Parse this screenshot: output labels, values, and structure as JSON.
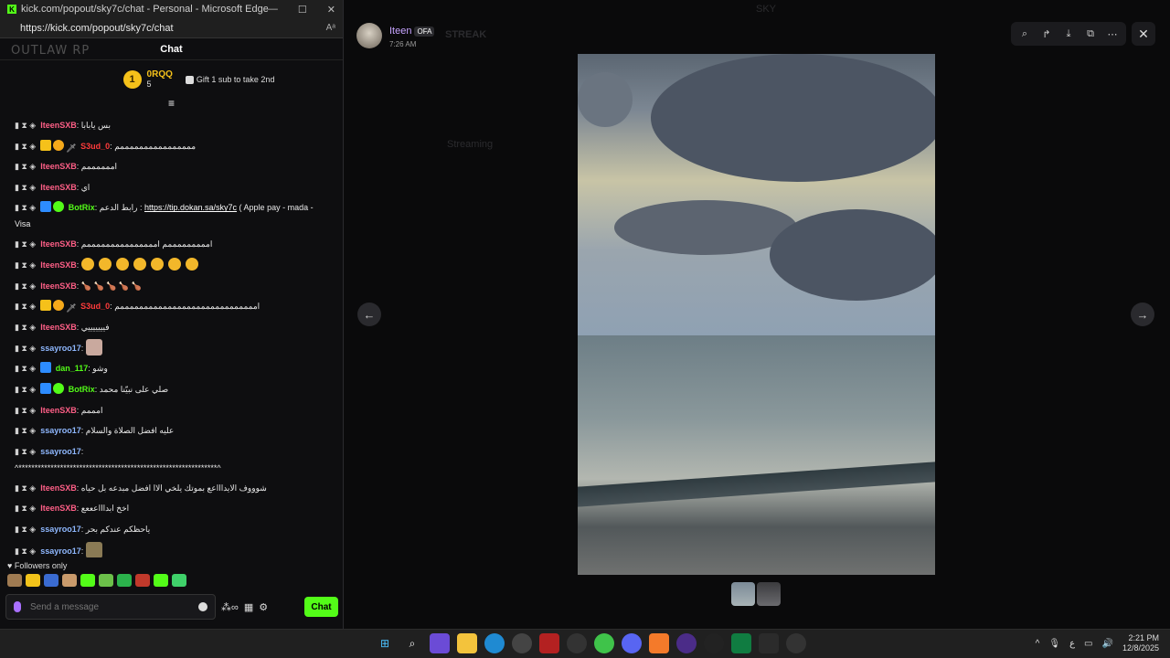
{
  "edge": {
    "title": "kick.com/popout/sky7c/chat - Personal - Microsoft Edge",
    "url": "https://kick.com/popout/sky7c/chat",
    "minimize": "—",
    "maximize": "☐",
    "close": "✕"
  },
  "chat": {
    "header": "Chat",
    "watermark": "OUTLAW RP",
    "top_gifter": {
      "rank": "1",
      "name": "0RQQ",
      "count": "5"
    },
    "gift_cta": "Gift 1 sub to take 2nd",
    "messages": [
      {
        "user": "IteenSXB",
        "text": "بس يابابا"
      },
      {
        "user": "S3ud_0",
        "text": "ممممممممممممممممم"
      },
      {
        "user": "IteenSXB",
        "text": "اممممممم"
      },
      {
        "user": "IteenSXB",
        "text": "اي"
      },
      {
        "user": "BotRix",
        "text_before": "رابط الدعم : ",
        "link": "https://tip.dokan.sa/sky7c",
        "text_after": " ( Apple pay - mada - Visa"
      },
      {
        "user": "IteenSXB",
        "text": "امممممممممم امممممممممممممممم"
      },
      {
        "user": "IteenSXB",
        "text": ""
      },
      {
        "user": "IteenSXB",
        "text": "🍗 🍗 🍗 🍗 🍗"
      },
      {
        "user": "S3ud_0",
        "text": "امممممممممممممممممممممممممممممم"
      },
      {
        "user": "IteenSXB",
        "text": "فيييييييي"
      },
      {
        "user": "ssayroo17",
        "text": ""
      },
      {
        "user": "dan_117",
        "text": "وشو"
      },
      {
        "user": "BotRix",
        "text": "صلي على نبيّنا محمد"
      },
      {
        "user": "IteenSXB",
        "text": "امممم"
      },
      {
        "user": "ssayroo17",
        "text": "عليه افضل الصلاة والسلام"
      },
      {
        "user": "ssayroo17",
        "text": ""
      },
      {
        "user": "",
        "text": "^**************************************************************^"
      },
      {
        "user": "IteenSXB",
        "text": "شوووف الايداااعع بموتك يلخي الاا افضل مبدعه بل حياه"
      },
      {
        "user": "IteenSXB",
        "text": "اخخ ابداااعععع"
      },
      {
        "user": "ssayroo17",
        "text": "ياحظكم عندكم بحر"
      },
      {
        "user": "ssayroo17",
        "text": ""
      }
    ],
    "followers_only": "Followers only",
    "input_placeholder": "Send a message",
    "send_label": "Chat"
  },
  "viewer": {
    "poster": "Iteen",
    "tag": "OFA",
    "time": "7:26 AM",
    "prev": "←",
    "next": "→",
    "close": "✕",
    "tools": [
      "⌕",
      "↱",
      "⤓",
      "⧉",
      "⋯"
    ]
  },
  "discord_bg": {
    "window_title": "SKY",
    "channel": "STREAK",
    "streaming": "Streaming"
  },
  "taskbar": {
    "time": "2:21 PM",
    "date": "12/8/2025",
    "lang": "ع"
  },
  "colors": {
    "kick_green": "#53fc18",
    "gold": "#f5c11a",
    "username_pink": "#ff5f87",
    "username_blue": "#8fb8ff"
  }
}
